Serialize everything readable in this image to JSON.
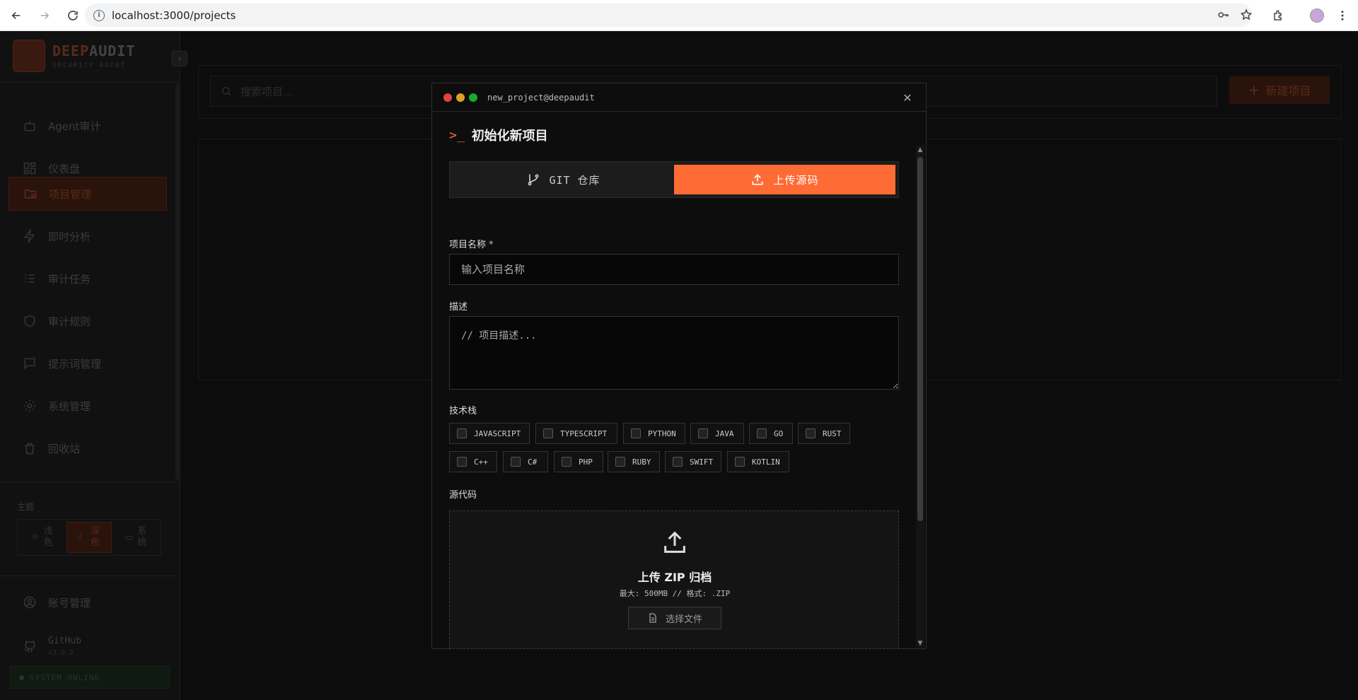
{
  "browser": {
    "url": "localhost:3000/projects"
  },
  "sidebar": {
    "logo_primary": "DEEP",
    "logo_secondary": "AUDIT",
    "logo_subtitle": "SECURITY AGENT",
    "items": [
      {
        "label": "Agent审计",
        "icon": "robot-icon"
      },
      {
        "label": "仪表盘",
        "icon": "dashboard-icon"
      },
      {
        "label": "项目管理",
        "icon": "folder-icon",
        "active": true
      },
      {
        "label": "即时分析",
        "icon": "lightning-icon"
      },
      {
        "label": "审计任务",
        "icon": "list-check-icon"
      },
      {
        "label": "审计规则",
        "icon": "shield-icon"
      },
      {
        "label": "提示词管理",
        "icon": "chat-icon"
      },
      {
        "label": "系统管理",
        "icon": "gear-icon"
      },
      {
        "label": "回收站",
        "icon": "trash-icon"
      }
    ],
    "theme_label": "主题",
    "theme_options": [
      {
        "label": "浅色",
        "icon": "sun-icon"
      },
      {
        "label": "深色",
        "icon": "moon-icon",
        "active": true
      },
      {
        "label": "系统",
        "icon": "monitor-icon"
      }
    ],
    "account_label": "账号管理",
    "github_label": "GitHub",
    "version": "v3.0.2",
    "status": "SYSTEM ONLINE"
  },
  "main": {
    "search_placeholder": "搜索项目...",
    "new_project_label": "新建项目"
  },
  "modal": {
    "window_title": "new_project@deepaudit",
    "heading": "初始化新项目",
    "tabs": [
      {
        "label": "GIT 仓库",
        "icon": "git-branch-icon"
      },
      {
        "label": "上传源码",
        "icon": "upload-icon",
        "active": true
      }
    ],
    "name_label": "项目名称",
    "required_mark": "*",
    "name_placeholder": "输入项目名称",
    "desc_label": "描述",
    "desc_placeholder": "// 项目描述...",
    "tech_label": "技术栈",
    "tech_stack": [
      "JAVASCRIPT",
      "TYPESCRIPT",
      "PYTHON",
      "JAVA",
      "GO",
      "RUST",
      "C++",
      "C#",
      "PHP",
      "RUBY",
      "SWIFT",
      "KOTLIN"
    ],
    "source_label": "源代码",
    "upload_title": "上传 ZIP 归档",
    "upload_hint": "最大: 500MB // 格式: .ZIP",
    "choose_file_label": "选择文件"
  },
  "colors": {
    "accent": "#ff6b35",
    "dot_red": "#e0443e",
    "dot_yellow": "#dea123",
    "dot_green": "#1aab29"
  }
}
